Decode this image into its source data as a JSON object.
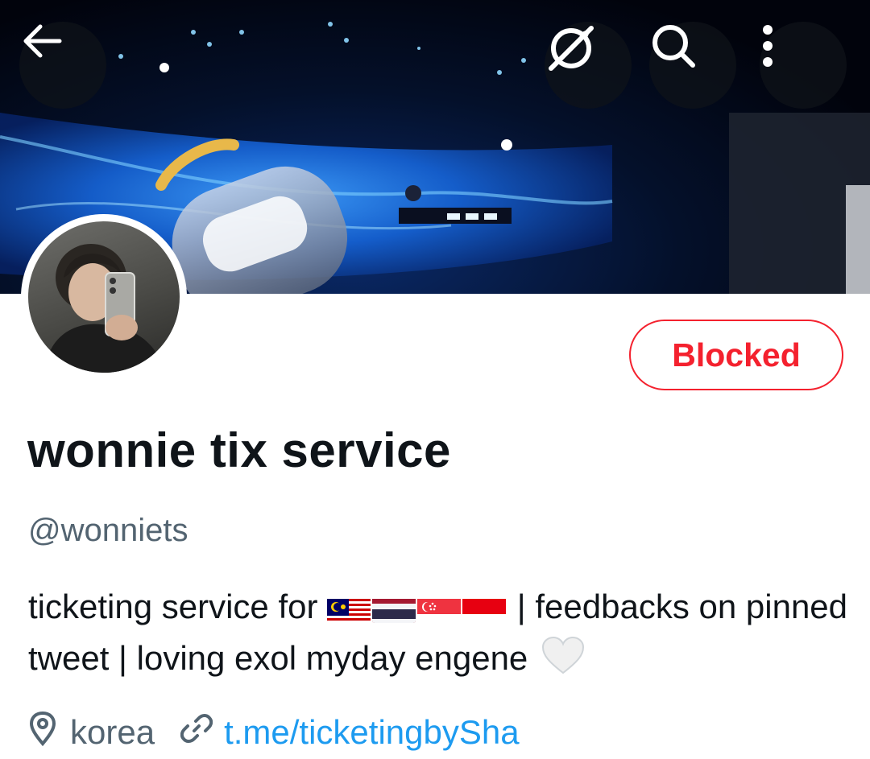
{
  "header": {
    "back_icon": "arrow-left-icon",
    "grok_icon": "grok-icon",
    "search_icon": "search-icon",
    "more_icon": "more-vertical-icon"
  },
  "profile": {
    "blocked_label": "Blocked",
    "display_name": "wonnie tix service",
    "handle": "@wonniets",
    "bio_part1": "ticketing service for ",
    "bio_flags": [
      "malaysia-flag",
      "thailand-flag",
      "singapore-flag",
      "indonesia-flag"
    ],
    "bio_part2": " | feedbacks on pinned tweet | loving exol myday engene ",
    "bio_emoji": "white-heart",
    "location": "korea",
    "location_icon": "location-pin-icon",
    "link": "t.me/ticketingbySha",
    "link_icon": "link-icon"
  },
  "colors": {
    "blocked": "#f4212e",
    "link": "#1d9bf0",
    "secondary_text": "#536471",
    "primary_text": "#0f1419"
  }
}
